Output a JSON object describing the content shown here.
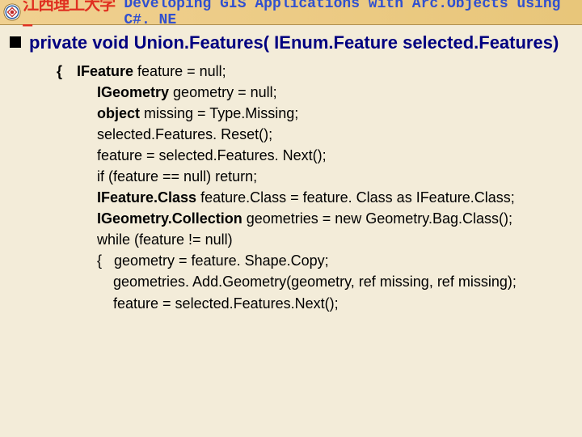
{
  "header": {
    "red_text": "江西理工大学 – ",
    "blue_text": "Developing GIS Applications with Arc.Objects using C#. NE"
  },
  "signature": "private void Union.Features( IEnum.Feature selected.Features)",
  "code": {
    "l1_kw": "IFeature",
    "l1_rest": " feature = null;",
    "l2_kw": "IGeometry",
    "l2_rest": " geometry = null;",
    "l3_kw": "object",
    "l3_rest": " missing = Type.Missing;",
    "l4": "selected.Features. Reset();",
    "l5": "feature = selected.Features. Next();",
    "l6": "if (feature == null) return;",
    "l7_kw": "IFeature.Class",
    "l7_rest": " feature.Class = feature. Class as IFeature.Class;",
    "l8_kw": "IGeometry.Collection",
    "l8_rest": " geometries = new Geometry.Bag.Class();",
    "l9": "while (feature != null)",
    "l10": "{   geometry = feature. Shape.Copy;",
    "l11": "geometries. Add.Geometry(geometry, ref missing, ref missing);",
    "l12": "feature = selected.Features.Next();"
  }
}
